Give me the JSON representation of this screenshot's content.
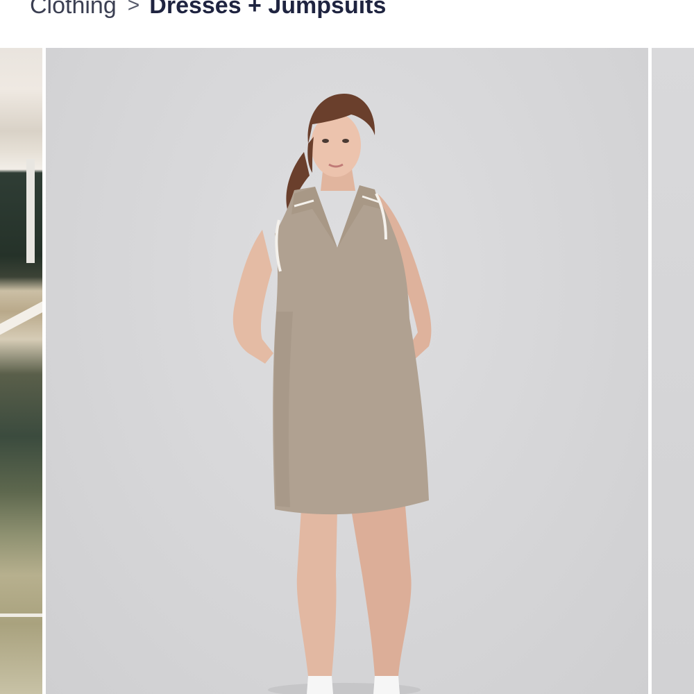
{
  "breadcrumb": {
    "parent_label": "Clothing",
    "separator": ">",
    "current_label": "Dresses + Jumpsuits"
  },
  "gallery": {
    "background_color": "#d7d7d9",
    "dress_color": "#b0a191",
    "trim_color": "#f4f1ec"
  }
}
